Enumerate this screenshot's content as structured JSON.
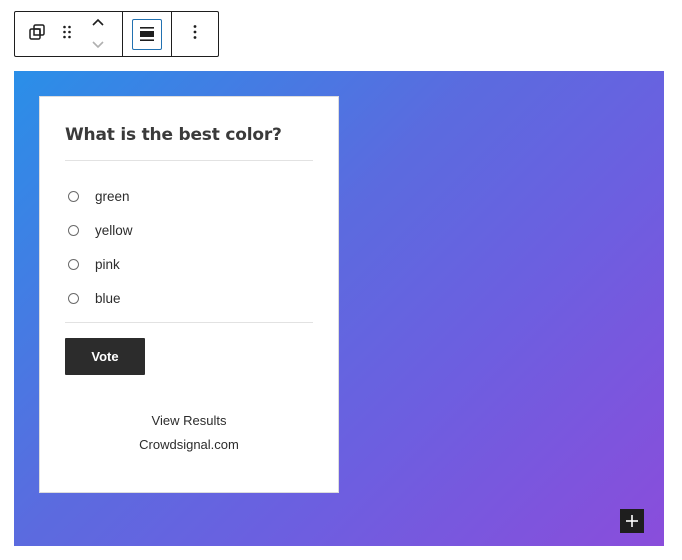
{
  "toolbar": {
    "icons": {
      "parent": "select-parent-icon",
      "drag": "drag-handle-icon",
      "move_up": "chevron-up-icon",
      "move_down": "chevron-down-icon",
      "align": "align-wide-icon",
      "more": "more-vertical-icon"
    },
    "accent_color": "#2271b1"
  },
  "cover": {
    "gradient_colors": [
      "#2a8fe8",
      "#5b6bdf",
      "#6c5fe0",
      "#8a4ddb"
    ]
  },
  "poll": {
    "question": "What is the best color?",
    "options": [
      {
        "label": "green"
      },
      {
        "label": "yellow"
      },
      {
        "label": "pink"
      },
      {
        "label": "blue"
      }
    ],
    "vote_label": "Vote",
    "view_results_label": "View Results",
    "branding_label": "Crowdsignal.com"
  },
  "inserter": {
    "icon": "plus-icon"
  }
}
